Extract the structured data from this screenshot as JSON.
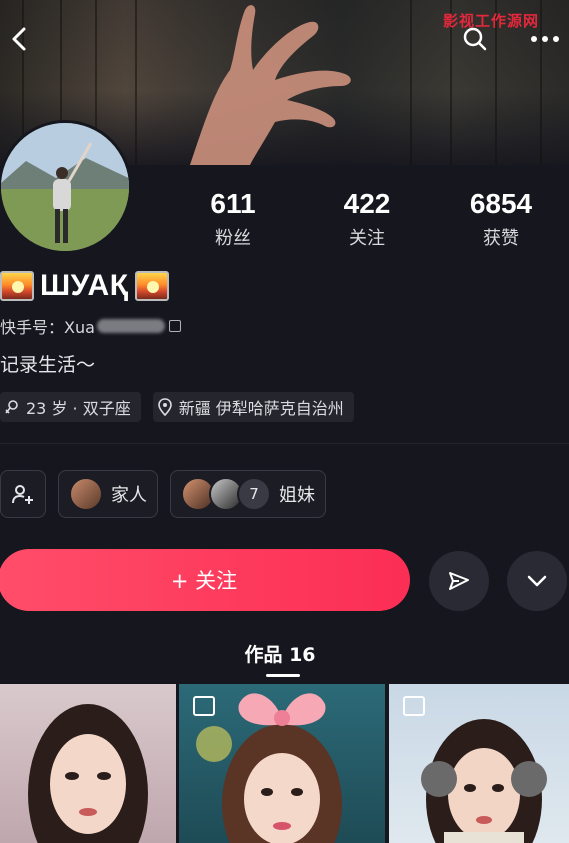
{
  "header": {
    "back_icon": "back-chevron-icon",
    "search_icon": "search-icon",
    "more_icon": "more-dots-icon",
    "watermark": "影视工作源网"
  },
  "profile": {
    "name": "ШУАҚ",
    "kuaishou_label": "快手号：Xua",
    "bio": "记录生活～",
    "tags": [
      "23 岁 · 双子座",
      "新疆 伊犁哈萨克自治州"
    ]
  },
  "stats": [
    {
      "value": "611",
      "label": "粉丝"
    },
    {
      "value": "422",
      "label": "关注"
    },
    {
      "value": "6854",
      "label": "获赞"
    }
  ],
  "relations": [
    {
      "label": "家人"
    },
    {
      "count": "7",
      "label": "姐妹"
    }
  ],
  "actions": {
    "follow_label": "+ 关注",
    "share_icon": "send-icon",
    "expand_icon": "chevron-down-icon"
  },
  "tabs": {
    "works_label": "作品 16"
  },
  "colors": {
    "background": "#16161e",
    "accent": "#fe3a5c",
    "card": "#25252e"
  }
}
